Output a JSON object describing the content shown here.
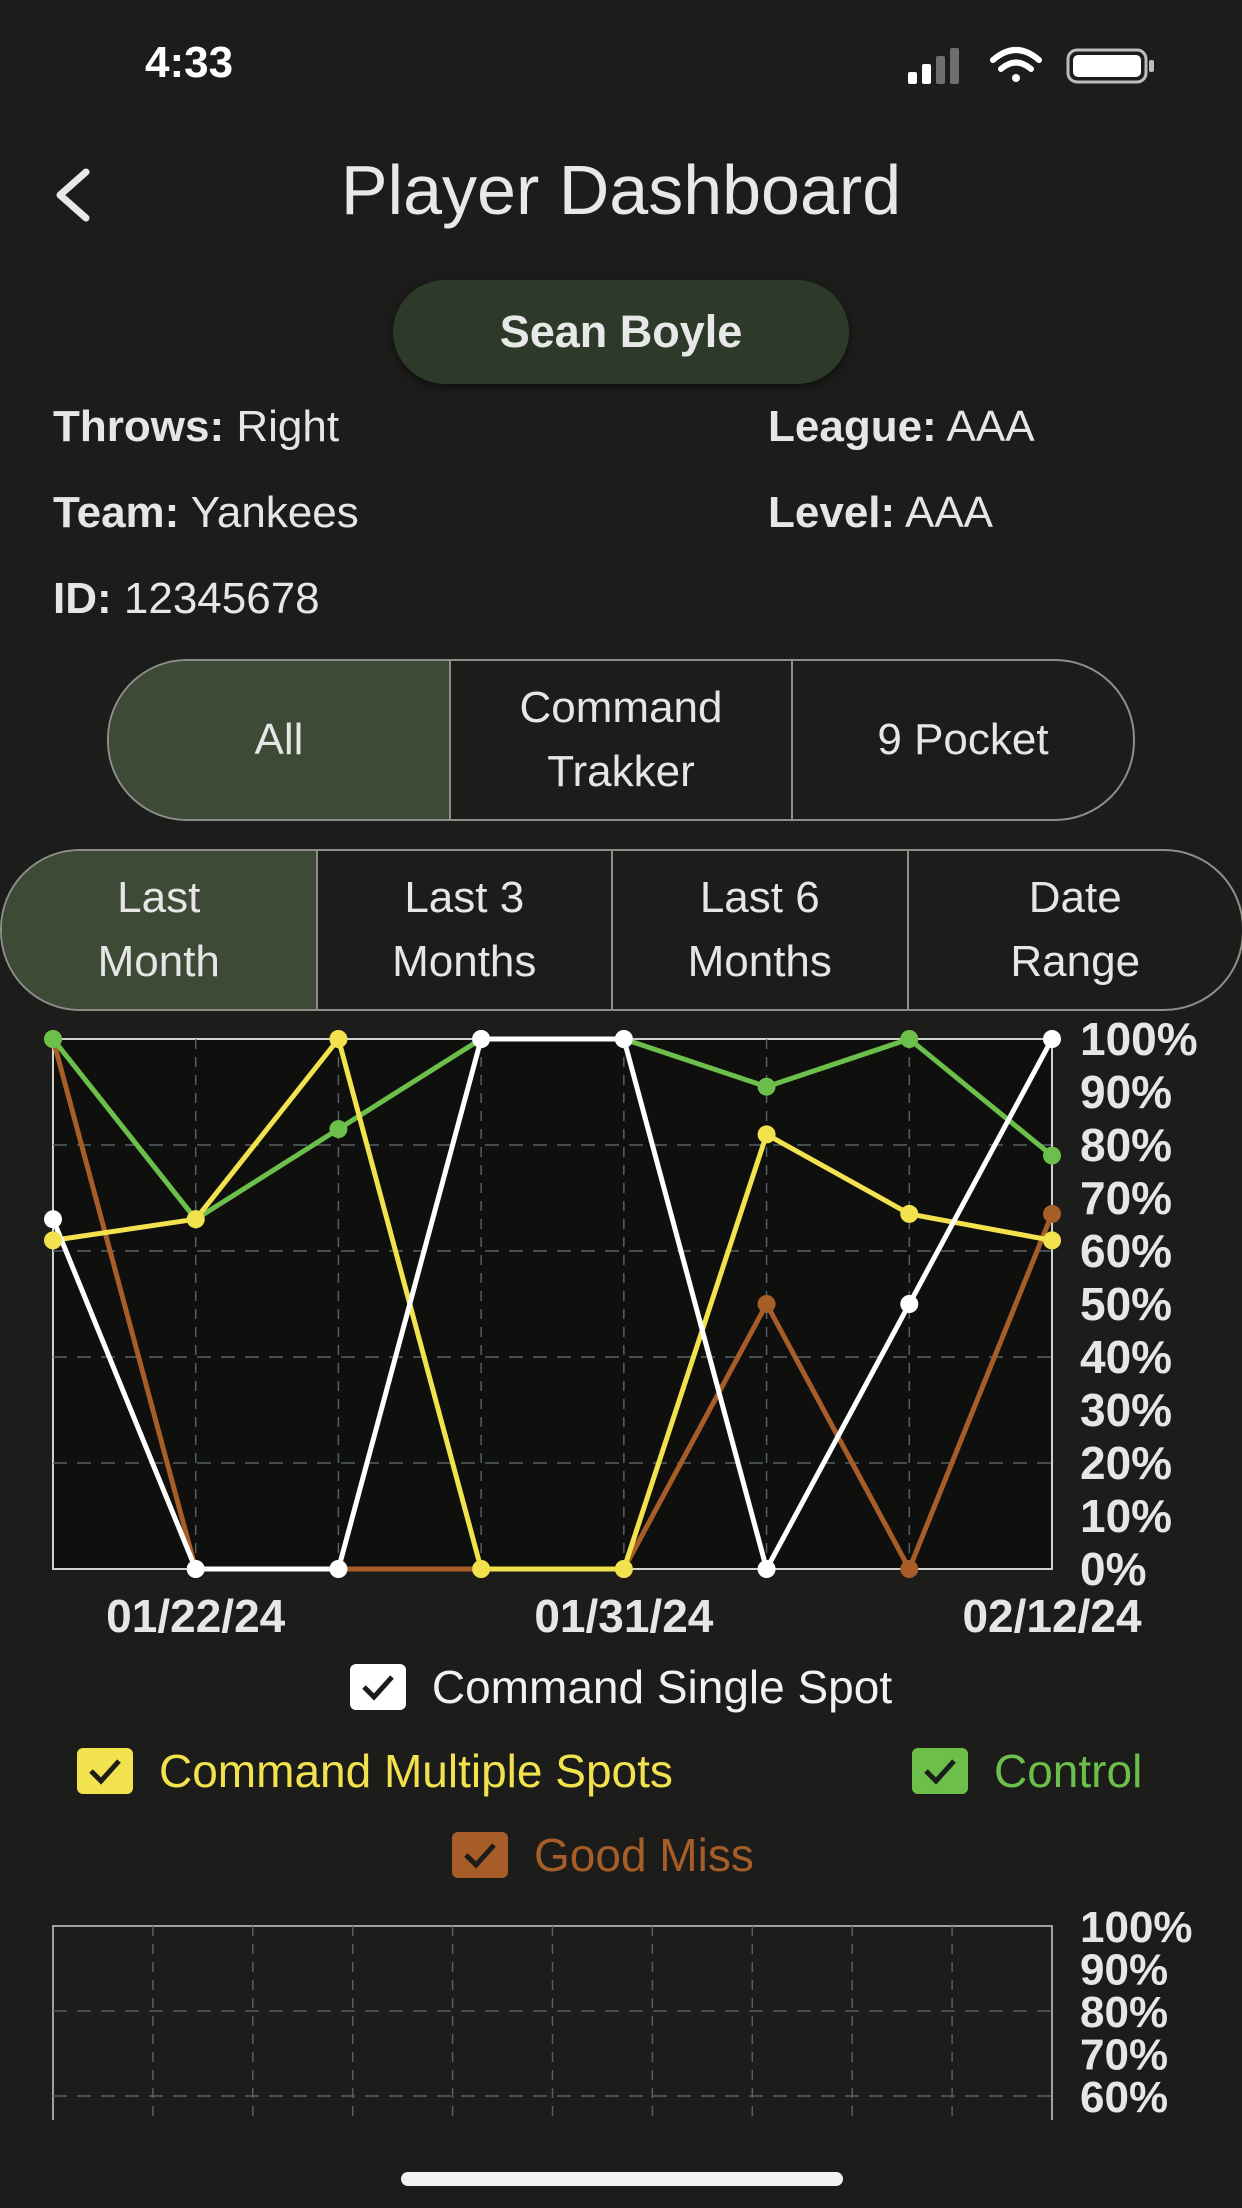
{
  "status": {
    "time": "4:33"
  },
  "header": {
    "title": "Player Dashboard"
  },
  "player": {
    "name": "Sean Boyle",
    "throws_label": "Throws:",
    "throws": "Right",
    "league_label": "League:",
    "league": "AAA",
    "team_label": "Team:",
    "team": "Yankees",
    "level_label": "Level:",
    "level": "AAA",
    "id_label": "ID:",
    "id": "12345678"
  },
  "source_tabs": [
    {
      "label": "All",
      "active": true
    },
    {
      "label": "Command Trakker",
      "active": false
    },
    {
      "label": "9 Pocket",
      "active": false
    }
  ],
  "range_tabs": [
    {
      "label": "Last Month",
      "active": true
    },
    {
      "label": "Last 3 Months",
      "active": false
    },
    {
      "label": "Last 6 Months",
      "active": false
    },
    {
      "label": "Date Range",
      "active": false
    }
  ],
  "chart_data": [
    {
      "type": "line",
      "title": "",
      "x_tick_labels": [
        "01/22/24",
        "01/31/24",
        "02/12/24"
      ],
      "x_points": 8,
      "y_ticks": [
        "100%",
        "90%",
        "80%",
        "70%",
        "60%",
        "50%",
        "40%",
        "30%",
        "20%",
        "10%",
        "0%"
      ],
      "ylim": [
        0,
        100
      ],
      "grid": true,
      "series": [
        {
          "name": "Command Single Spot",
          "color": "#ffffff",
          "values": [
            66,
            0,
            0,
            100,
            100,
            0,
            50,
            100
          ]
        },
        {
          "name": "Command Multiple Spots",
          "color": "#f2e24e",
          "values": [
            62,
            66,
            100,
            0,
            0,
            82,
            67,
            62
          ]
        },
        {
          "name": "Control",
          "color": "#6cbf4a",
          "values": [
            100,
            66,
            83,
            100,
            100,
            91,
            100,
            78
          ]
        },
        {
          "name": "Good Miss",
          "color": "#a65d28",
          "values": [
            100,
            0,
            0,
            0,
            0,
            50,
            0,
            67
          ]
        }
      ]
    },
    {
      "type": "line",
      "y_ticks": [
        "100%",
        "90%",
        "80%",
        "70%",
        "60%"
      ],
      "ylim": [
        60,
        100
      ],
      "grid": true,
      "series": []
    }
  ]
}
